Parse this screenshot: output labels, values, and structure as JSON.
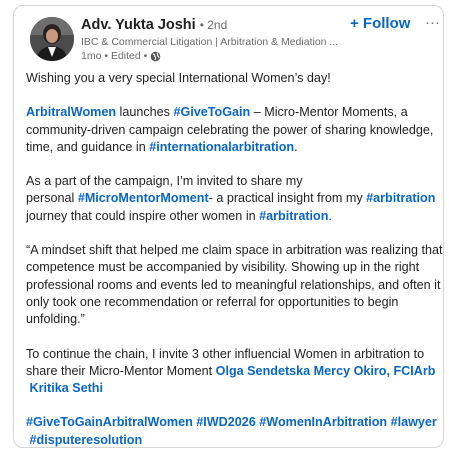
{
  "author": {
    "name": "Adv. Yukta Joshi",
    "degree": "• 2nd",
    "headline": "IBC & Commercial Litigation | Arbitration & Mediation ...",
    "time": "1mo",
    "edited": "• Edited •"
  },
  "actions": {
    "follow_label": "+ Follow",
    "more_glyph": "···"
  },
  "post": {
    "p1": "Wishing you a very special International Women’s day!",
    "p2": {
      "l1_link1": "ArbitralWomen",
      "l1_text1": " launches ",
      "l1_link2": "#GiveToGain",
      "l1_text2": " – Micro-Mentor Moments, a",
      "l2": "community-driven campaign celebrating the power of sharing knowledge,",
      "l3_text": "time, and guidance in ",
      "l3_link": "#internationalarbitration",
      "l3_end": "."
    },
    "p3": {
      "l1": "As a part of the campaign, I’m invited to share my",
      "l2_text1": "personal ",
      "l2_link1": "#MicroMentorMoment",
      "l2_text2": "- a practical insight from my ",
      "l2_link2": "#arbitration",
      "l3_text1": " journey that could inspire other women in ",
      "l3_link": "#arbitration",
      "l3_end": "."
    },
    "p4": {
      "l1": "“A mindset shift that helped me claim space in arbitration was realizing that",
      "l2": "competence must be accompanied by visibility. Showing up in the right",
      "l3": "professional rooms and events led to meaningful relationships, and often it",
      "l4": "only took one recommendation or referral for opportunities to begin",
      "l5": "unfolding.”"
    },
    "p5": {
      "l1": "To continue the chain, I invite 3 other influencial Women in arbitration to",
      "l2_text": "share their Micro-Mentor Moment ",
      "l2_mention1": "Olga Sendetska",
      "l2_mention2": "Mercy Okiro, FCIArb",
      "l3_mention3": "Kritika Sethi"
    },
    "hashtags": {
      "h1": "#GiveToGainArbitralWomen",
      "h2": "#IWD2026",
      "h3": "#WomenInArbitration",
      "h4": "#lawyer",
      "h5": "#disputeresolution"
    }
  },
  "icons": {
    "avatar": "avatar-photo",
    "visibility": "globe-icon",
    "more": "more-horizontal-icon"
  },
  "colors": {
    "link": "#0a66c2",
    "text": "#1f1f1f",
    "secondary": "#6b6b6b",
    "border": "#d6d6d6"
  }
}
